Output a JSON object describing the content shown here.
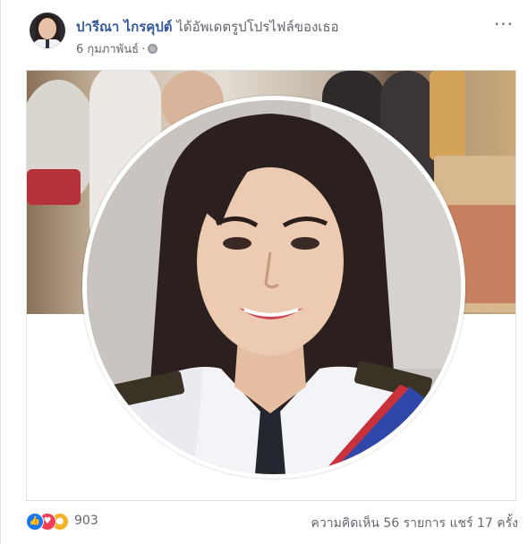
{
  "post": {
    "author_name": "ปารีณา ไกรคุปต์",
    "action_text": "ได้อัพเดตรูปโปรไฟล์ของเธอ",
    "date": "6 กุมภาพันธ์",
    "separator": "·",
    "privacy_icon": "globe-icon",
    "more_icon": "ellipsis-icon",
    "more_label": "···"
  },
  "footer": {
    "reaction_icons": [
      "like-icon",
      "love-icon",
      "wow-icon"
    ],
    "reaction_count": "903",
    "comments_text": "ความคิดเห็น 56 รายการ",
    "shares_text": "แชร์ 17 ครั้ง"
  },
  "colors": {
    "name_link": "#365899",
    "meta_text": "#616770",
    "like_blue": "#1877f2",
    "love_red": "#f33e58",
    "wow_yellow": "#f7b125"
  }
}
